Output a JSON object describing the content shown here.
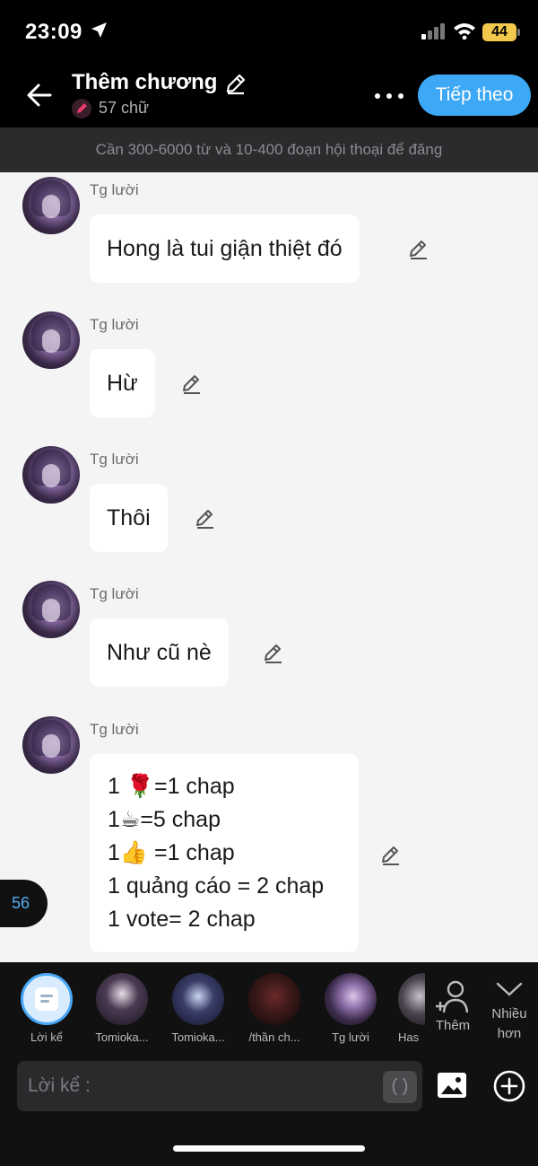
{
  "status_bar": {
    "time": "23:09",
    "battery": "44"
  },
  "header": {
    "title": "Thêm chương",
    "word_count": "57 chữ",
    "next_label": "Tiếp theo"
  },
  "requirement": "Cần 300-6000 từ và 10-400 đoạn hội thoại để đăng",
  "messages": [
    {
      "sender": "Tg lười",
      "lines": [
        "Hong là tui giận thiệt đó"
      ]
    },
    {
      "sender": "Tg lười",
      "lines": [
        "Hừ"
      ]
    },
    {
      "sender": "Tg lười",
      "lines": [
        "Thôi"
      ]
    },
    {
      "sender": "Tg lười",
      "lines": [
        "Như cũ nè"
      ]
    },
    {
      "sender": "Tg lười",
      "lines": [
        "1 🌹=1 chap",
        "1☕=5 chap",
        "1👍 =1 chap",
        "1 quảng cáo = 2 chap",
        "1 vote= 2 chap"
      ]
    }
  ],
  "page_badge": "56",
  "characters": [
    {
      "label": "Lời kể"
    },
    {
      "label": "Tomioka..."
    },
    {
      "label": "Tomioka..."
    },
    {
      "label": "/thần ch..."
    },
    {
      "label": "Tg lười"
    },
    {
      "label": "Has"
    }
  ],
  "add_character_label": "Thêm",
  "more_label": "Nhiều hơn",
  "input": {
    "placeholder": "Lời kể :",
    "paren": "( )"
  },
  "colors": {
    "accent": "#3da8f5",
    "badge_text": "#4fb0f5",
    "battery": "#f2c94c"
  }
}
